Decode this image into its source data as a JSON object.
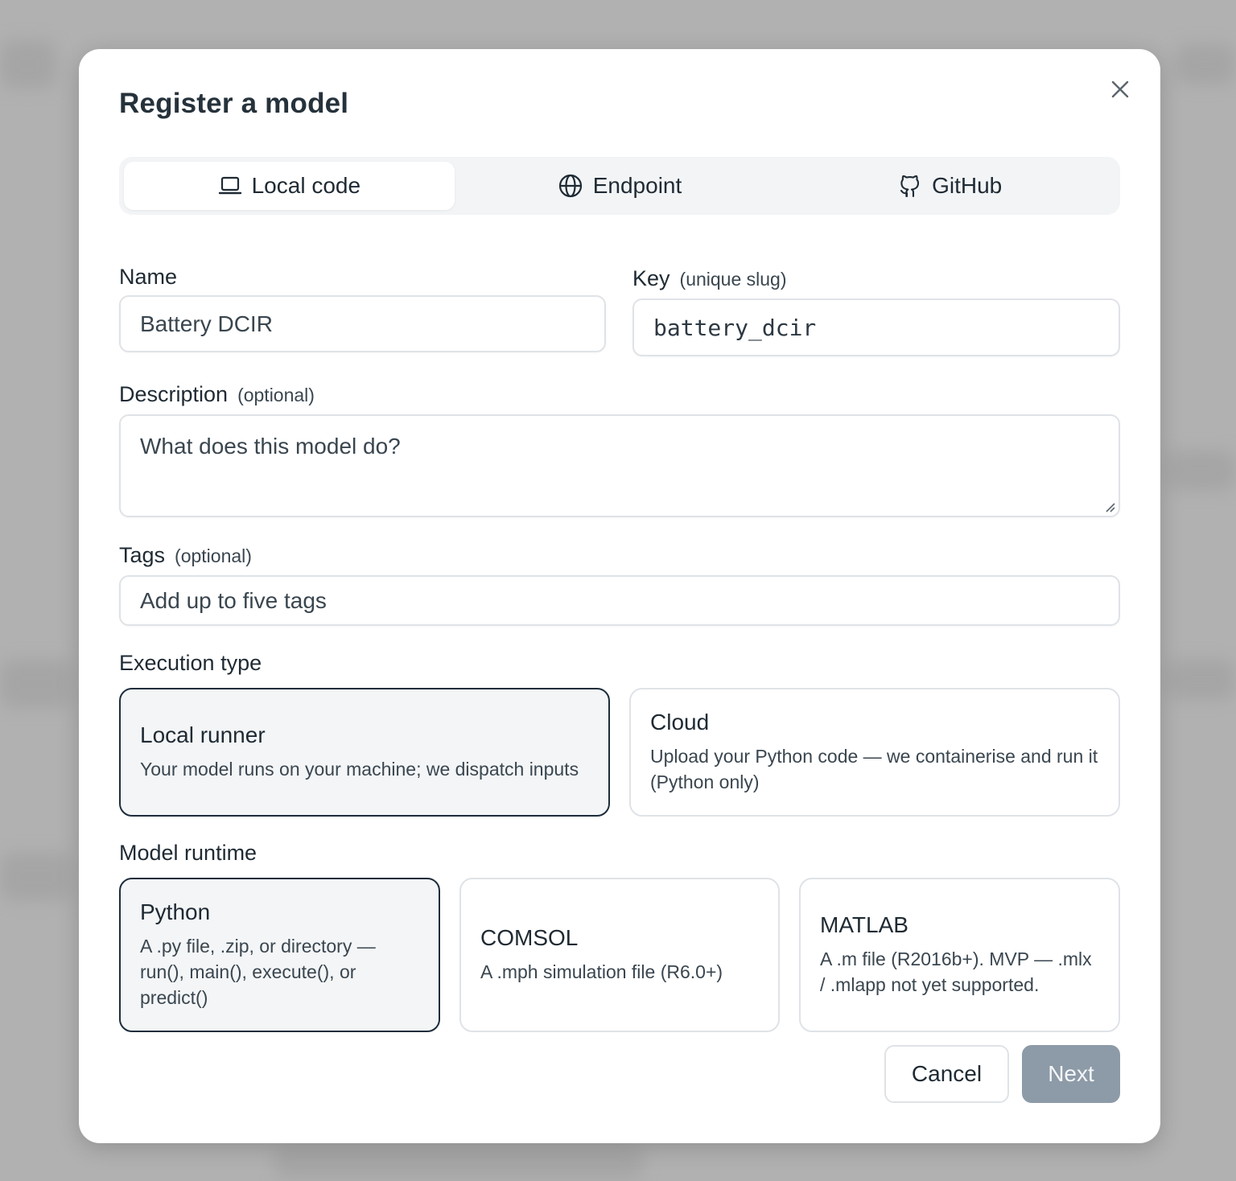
{
  "dialog": {
    "title": "Register a model",
    "close_icon": "close-icon"
  },
  "tabs": [
    {
      "label": "Local code",
      "icon": "laptop-icon",
      "active": true
    },
    {
      "label": "Endpoint",
      "icon": "globe-icon",
      "active": false
    },
    {
      "label": "GitHub",
      "icon": "github-icon",
      "active": false
    }
  ],
  "fields": {
    "name": {
      "label": "Name",
      "value": "Battery DCIR"
    },
    "key": {
      "label": "Key",
      "hint": "(unique slug)",
      "value": "battery_dcir"
    },
    "description": {
      "label": "Description",
      "hint": "(optional)",
      "placeholder": "What does this model do?"
    },
    "tags": {
      "label": "Tags",
      "hint": "(optional)",
      "placeholder": "Add up to five tags"
    }
  },
  "execution_type": {
    "label": "Execution type",
    "options": [
      {
        "title": "Local runner",
        "description": "Your model runs on your machine; we dispatch inputs",
        "selected": true
      },
      {
        "title": "Cloud",
        "description": "Upload your Python code — we containerise and run it (Python only)",
        "selected": false
      }
    ]
  },
  "model_runtime": {
    "label": "Model runtime",
    "options": [
      {
        "title": "Python",
        "description": "A .py file, .zip, or directory — run(), main(), execute(), or predict()",
        "selected": true
      },
      {
        "title": "COMSOL",
        "description": "A .mph simulation file (R6.0+)",
        "selected": false
      },
      {
        "title": "MATLAB",
        "description": "A .m file (R2016b+). MVP — .mlx / .mlapp not yet supported.",
        "selected": false
      }
    ]
  },
  "actions": {
    "cancel_label": "Cancel",
    "next_label": "Next"
  },
  "colors": {
    "selected_border": "#1d2d3c",
    "next_button": "#8d9aa7"
  }
}
